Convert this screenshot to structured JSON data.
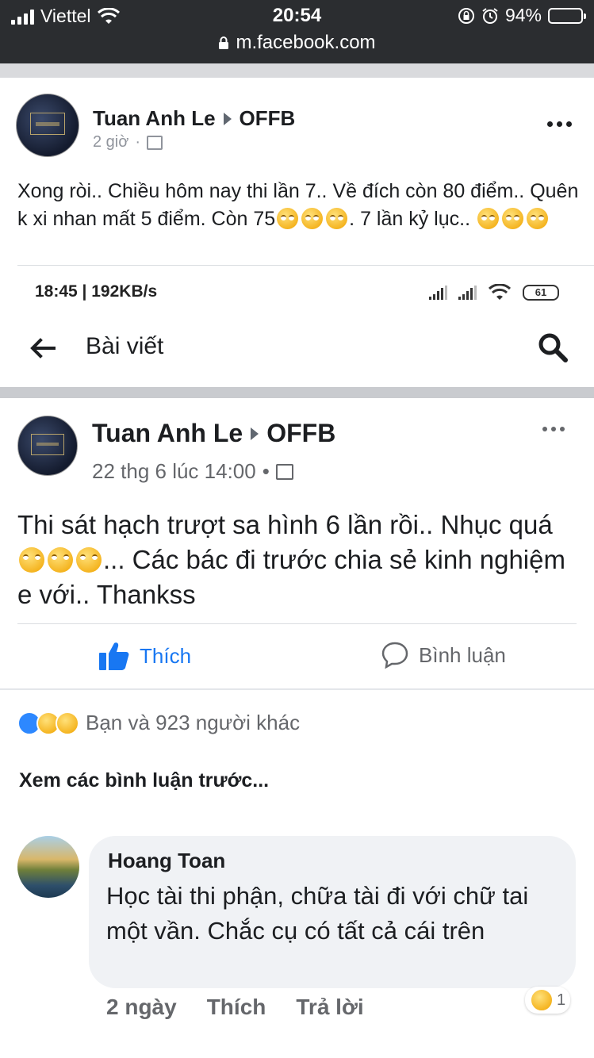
{
  "status_bar": {
    "carrier": "Viettel",
    "time": "20:54",
    "battery": "94%",
    "battery_level": 0.94,
    "url": "m.facebook.com"
  },
  "post": {
    "author": "Tuan Anh Le",
    "group": "OFFB",
    "time": "2 giờ",
    "text_parts": [
      "Xong ròi.. Chiều hôm nay thi lần 7.. Về đích còn 80 điểm.. Quên k xi nhan mất 5 điểm. Còn 75",
      ". 7 lần kỷ lục.."
    ],
    "emoji": "face-with-rolling-eyes"
  },
  "shared_screenshot": {
    "status_time": "18:45 | 192KB/s",
    "battery": "61",
    "header_title": "Bài viết",
    "post": {
      "author": "Tuan Anh Le",
      "group": "OFFB",
      "time": "22 thg 6 lúc 14:00",
      "text_parts": [
        "Thi sát hạch trượt sa hình 6 lần rồi..  Nhục quá",
        "... Các bác đi trước chia sẻ kinh nghiệm e với.. Thankss"
      ]
    },
    "like_label": "Thích",
    "comment_label": "Bình luận",
    "reactions_text": "Bạn và 923 người khác",
    "see_previous": "Xem các bình luận trước...",
    "comment": {
      "author": "Hoang Toan",
      "text": "Học tài thi phận, chữa tài đi với chữ tai một vần. Chắc cụ có tất cả cái trên",
      "age": "2 ngày",
      "like": "Thích",
      "reply": "Trả lời",
      "reaction_count": "1"
    }
  },
  "colors": {
    "facebook_blue": "#1877f2",
    "status_bar_bg": "#2b2d30",
    "divider_gray": "#d9dadd"
  }
}
